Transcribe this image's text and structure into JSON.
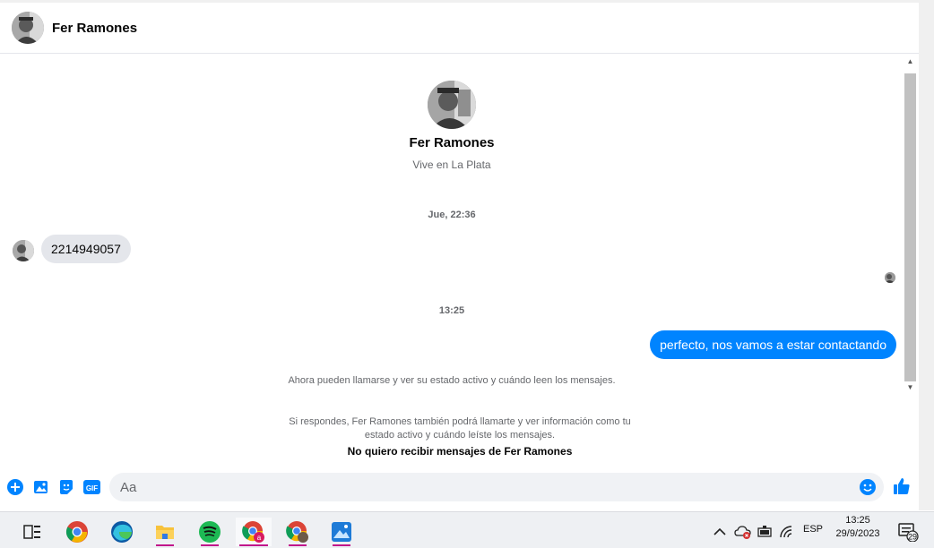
{
  "header": {
    "contact_name": "Fer Ramones"
  },
  "intro": {
    "name": "Fer Ramones",
    "subtitle": "Vive en La Plata"
  },
  "messages": {
    "timestamp_1": "Jue, 22:36",
    "incoming_1": "2214949057",
    "timestamp_2": "13:25",
    "outgoing_1": "perfecto, nos vamos a estar contactando"
  },
  "notices": {
    "call_notice": "Ahora pueden llamarse y ver su estado activo y cuándo leen los mensajes.",
    "reply_notice_line1": "Si respondes, Fer Ramones también podrá llamarte y ver información como tu",
    "reply_notice_line2": "estado activo y cuándo leíste los mensajes.",
    "block_link": "No quiero recibir mensajes de Fer Ramones"
  },
  "composer": {
    "placeholder": "Aa",
    "icons": [
      "plus-icon",
      "image-icon",
      "sticker-icon",
      "gif-icon",
      "emoji-icon",
      "like-icon"
    ],
    "gif_label": "GIF"
  },
  "taskbar": {
    "apps": [
      "task-view",
      "chrome",
      "edge",
      "file-explorer",
      "spotify",
      "chrome-profile-a",
      "chrome-profile-2",
      "photos"
    ],
    "language": "ESP",
    "time": "13:25",
    "date": "29/9/2023",
    "notification_count": "29"
  },
  "colors": {
    "accent": "#0084ff",
    "bubble_in": "#e4e6eb",
    "taskbar": "#eef0f3"
  }
}
